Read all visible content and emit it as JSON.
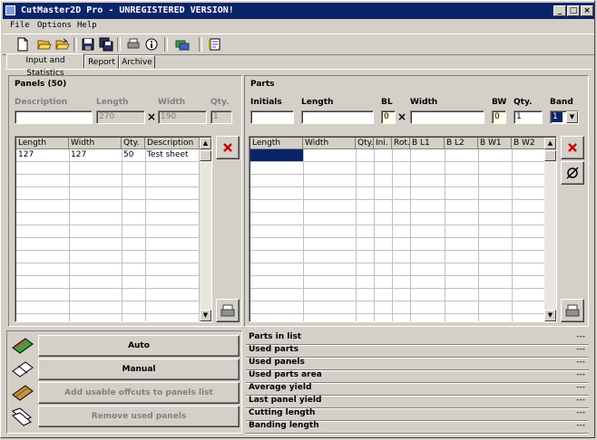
{
  "window": {
    "title": "CutMaster2D Pro - UNREGISTERED VERSION!"
  },
  "menu": {
    "file": "File",
    "options": "Options",
    "help": "Help"
  },
  "toolbar": {
    "icons": [
      "new-document-icon",
      "open-folder-icon",
      "open-folder-2-icon",
      "save-disk-icon",
      "save-all-icon",
      "print-icon",
      "info-icon",
      "currency-icon",
      "notebook-icon"
    ]
  },
  "tabs": [
    {
      "label": "Input and Statistics"
    },
    {
      "label": "Report"
    },
    {
      "label": "Archive"
    }
  ],
  "panels": {
    "title": "Panels (50)",
    "labels": {
      "description": "Description",
      "length": "Length",
      "width": "Width",
      "qty": "Qty."
    },
    "inputs": {
      "description": "",
      "length": "270",
      "width": "190",
      "qty": "1"
    },
    "times": "×",
    "columns": [
      "Length",
      "Width",
      "Qty.",
      "Description"
    ],
    "rows": [
      {
        "length": "127",
        "width": "127",
        "qty": "50",
        "description": "Test sheet"
      }
    ]
  },
  "parts": {
    "title": "Parts",
    "labels": {
      "initials": "Initials",
      "length": "Length",
      "bl": "BL",
      "width": "Width",
      "bw": "BW",
      "qty": "Qty.",
      "band": "Band"
    },
    "inputs": {
      "initials": "",
      "length": "",
      "bl": "0",
      "width": "",
      "bw": "0",
      "qty": "1",
      "band": "1"
    },
    "times": "×",
    "columns": [
      "Length",
      "Width",
      "Qty.",
      "Ini.",
      "Rot.",
      "B L1",
      "B L2",
      "B W1",
      "B W2"
    ]
  },
  "actions": {
    "auto": "Auto",
    "manual": "Manual",
    "add_offcuts": "Add usable offcuts to panels list",
    "remove_used": "Remove used panels"
  },
  "stats": [
    {
      "label": "Parts in list",
      "value": "---"
    },
    {
      "label": "Used parts",
      "value": "---"
    },
    {
      "label": "Used panels",
      "value": "---"
    },
    {
      "label": "Used parts area",
      "value": "---"
    },
    {
      "label": "Average yield",
      "value": "---"
    },
    {
      "label": "Last panel yield",
      "value": "---"
    },
    {
      "label": "Cutting length",
      "value": "---"
    },
    {
      "label": "Banding length",
      "value": "---"
    }
  ],
  "colors": {
    "titlebar": "#0a246a",
    "selection": "#0a246a",
    "face": "#d4d0c8",
    "delete_red": "#cc0000"
  }
}
